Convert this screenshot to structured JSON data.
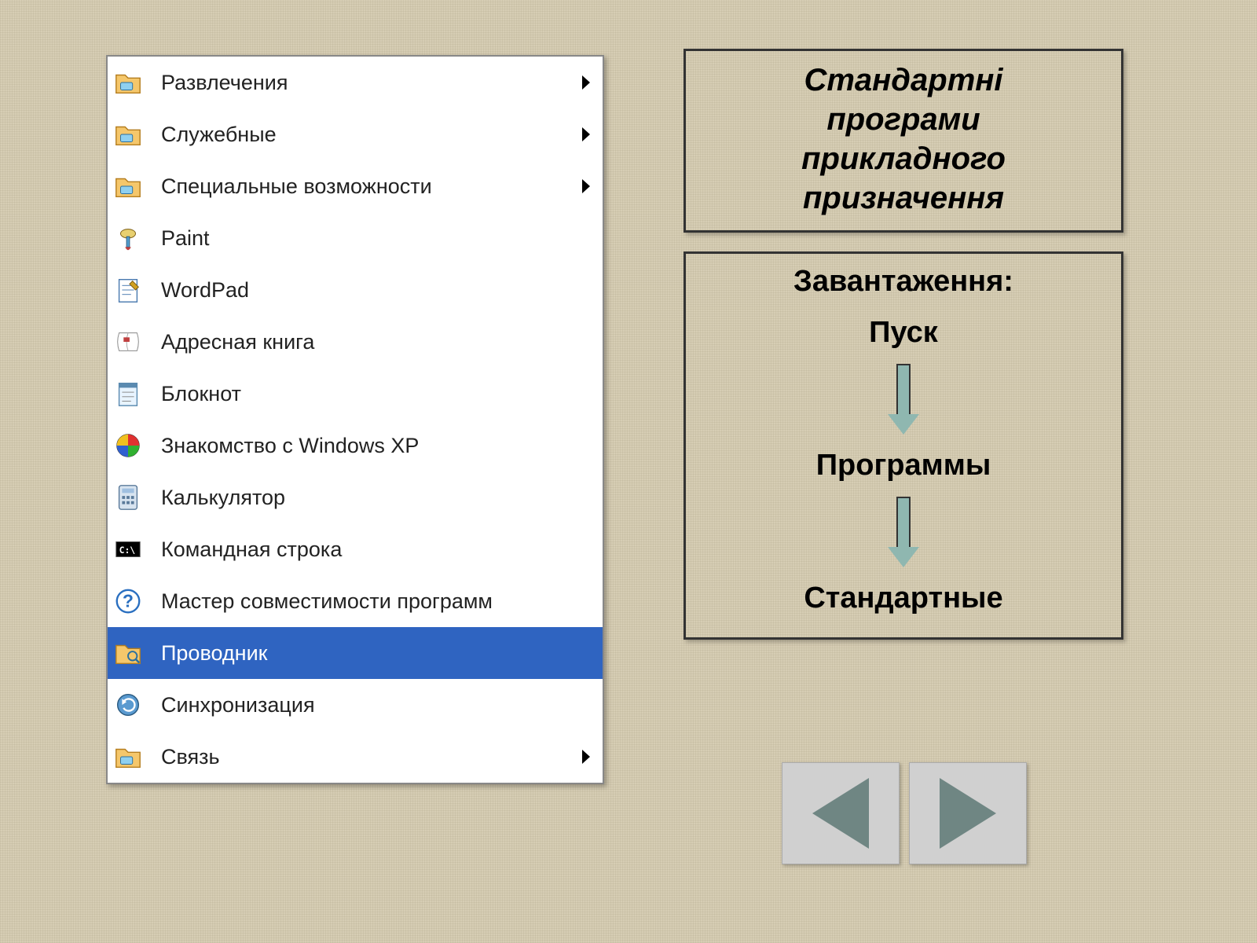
{
  "menu": {
    "items": [
      {
        "label": "Развлечения",
        "icon": "folder-icon",
        "submenu": true,
        "selected": false
      },
      {
        "label": "Служебные",
        "icon": "folder-icon",
        "submenu": true,
        "selected": false
      },
      {
        "label": "Специальные возможности",
        "icon": "folder-icon",
        "submenu": true,
        "selected": false
      },
      {
        "label": "Paint",
        "icon": "paint-icon",
        "submenu": false,
        "selected": false
      },
      {
        "label": "WordPad",
        "icon": "wordpad-icon",
        "submenu": false,
        "selected": false
      },
      {
        "label": "Адресная книга",
        "icon": "addressbook-icon",
        "submenu": false,
        "selected": false
      },
      {
        "label": "Блокнот",
        "icon": "notepad-icon",
        "submenu": false,
        "selected": false
      },
      {
        "label": "Знакомство с Windows XP",
        "icon": "tour-icon",
        "submenu": false,
        "selected": false
      },
      {
        "label": "Калькулятор",
        "icon": "calculator-icon",
        "submenu": false,
        "selected": false
      },
      {
        "label": "Командная строка",
        "icon": "cmd-icon",
        "submenu": false,
        "selected": false
      },
      {
        "label": "Мастер совместимости программ",
        "icon": "help-icon",
        "submenu": false,
        "selected": false
      },
      {
        "label": "Проводник",
        "icon": "explorer-icon",
        "submenu": false,
        "selected": true
      },
      {
        "label": "Синхронизация",
        "icon": "sync-icon",
        "submenu": false,
        "selected": false
      },
      {
        "label": "Связь",
        "icon": "folder-icon",
        "submenu": true,
        "selected": false
      }
    ]
  },
  "title_box": {
    "line1": "Стандартні",
    "line2": "програми",
    "line3": "прикладного",
    "line4": "призначення"
  },
  "path_box": {
    "heading": "Завантаження:",
    "step1": "Пуск",
    "step2": "Программы",
    "step3": "Стандартные"
  },
  "nav": {
    "prev": "previous",
    "next": "next"
  }
}
